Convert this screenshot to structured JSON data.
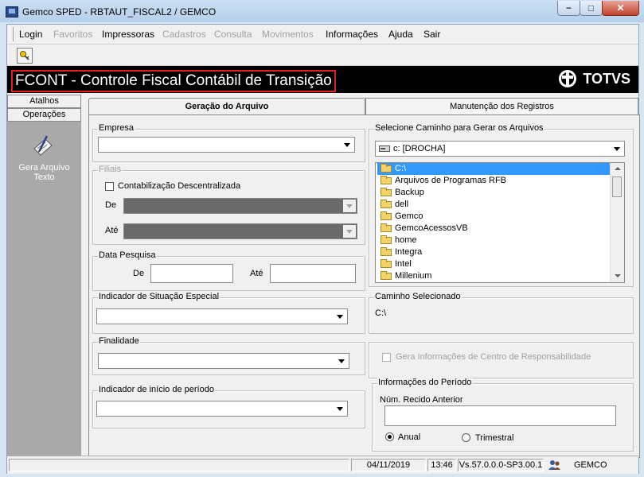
{
  "window": {
    "title": "Gemco SPED - RBTAUT_FISCAL2 / GEMCO",
    "minimize_glyph": "−",
    "maximize_glyph": "□",
    "close_glyph": "✕"
  },
  "menu": {
    "items": [
      {
        "label": "Login",
        "enabled": true
      },
      {
        "label": "Favoritos",
        "enabled": false
      },
      {
        "label": "Impressoras",
        "enabled": true
      },
      {
        "label": "Cadastros",
        "enabled": false
      },
      {
        "label": "Consulta",
        "enabled": false
      },
      {
        "label": "Movimentos",
        "enabled": false
      },
      {
        "label": "Informações",
        "enabled": true
      },
      {
        "label": "Ajuda",
        "enabled": true
      },
      {
        "label": "Sair",
        "enabled": true
      }
    ]
  },
  "header": {
    "title": "FCONT - Controle Fiscal Contábil de Transição",
    "logo": "TOTVS"
  },
  "sidebar": {
    "tabs": [
      "Atalhos",
      "Operações"
    ],
    "shortcut_label": "Gera Arquivo Texto"
  },
  "tabs": [
    {
      "label": "Geração do Arquivo",
      "active": true
    },
    {
      "label": "Manutenção dos Registros",
      "active": false
    }
  ],
  "form": {
    "empresa": {
      "label": "Empresa",
      "value": ""
    },
    "filiais": {
      "label": "Filiais",
      "checkbox_label": "Contabilização Descentralizada",
      "checked": false,
      "de_label": "De",
      "ate_label": "Até"
    },
    "data_pesquisa": {
      "label": "Data Pesquisa",
      "de_label": "De",
      "ate_label": "Até",
      "de_value": "",
      "ate_value": ""
    },
    "indicador_situacao": {
      "label": "Indicador de Situação Especial",
      "value": ""
    },
    "finalidade": {
      "label": "Finalidade",
      "value": ""
    },
    "indicador_inicio": {
      "label": "Indicador de início de período",
      "value": ""
    },
    "caminho": {
      "label": "Selecione Caminho  para Gerar os Arquivos",
      "drive": "c: [DROCHA]",
      "folders": [
        "C:\\",
        "Arquivos de Programas RFB",
        "Backup",
        "dell",
        "Gemco",
        "GemcoAcessosVB",
        "home",
        "Integra",
        "Intel",
        "Millenium"
      ],
      "selected_index": 0
    },
    "caminho_selecionado": {
      "label": "Caminho Selecionado",
      "value": "C:\\"
    },
    "centro_resp": {
      "label": "Gera Informações de Centro de Responsabilidade",
      "checked": false
    },
    "periodo": {
      "label": "Informações do  Período",
      "recibo_label": "Núm. Recido Anterior",
      "recibo_value": "",
      "options": [
        "Anual",
        "Trimestral"
      ],
      "selected": "Anual"
    }
  },
  "status": {
    "date": "04/11/2019",
    "time": "13:46",
    "version": "Vs.57.0.0.0-SP3.00.1",
    "company": "GEMCO"
  }
}
